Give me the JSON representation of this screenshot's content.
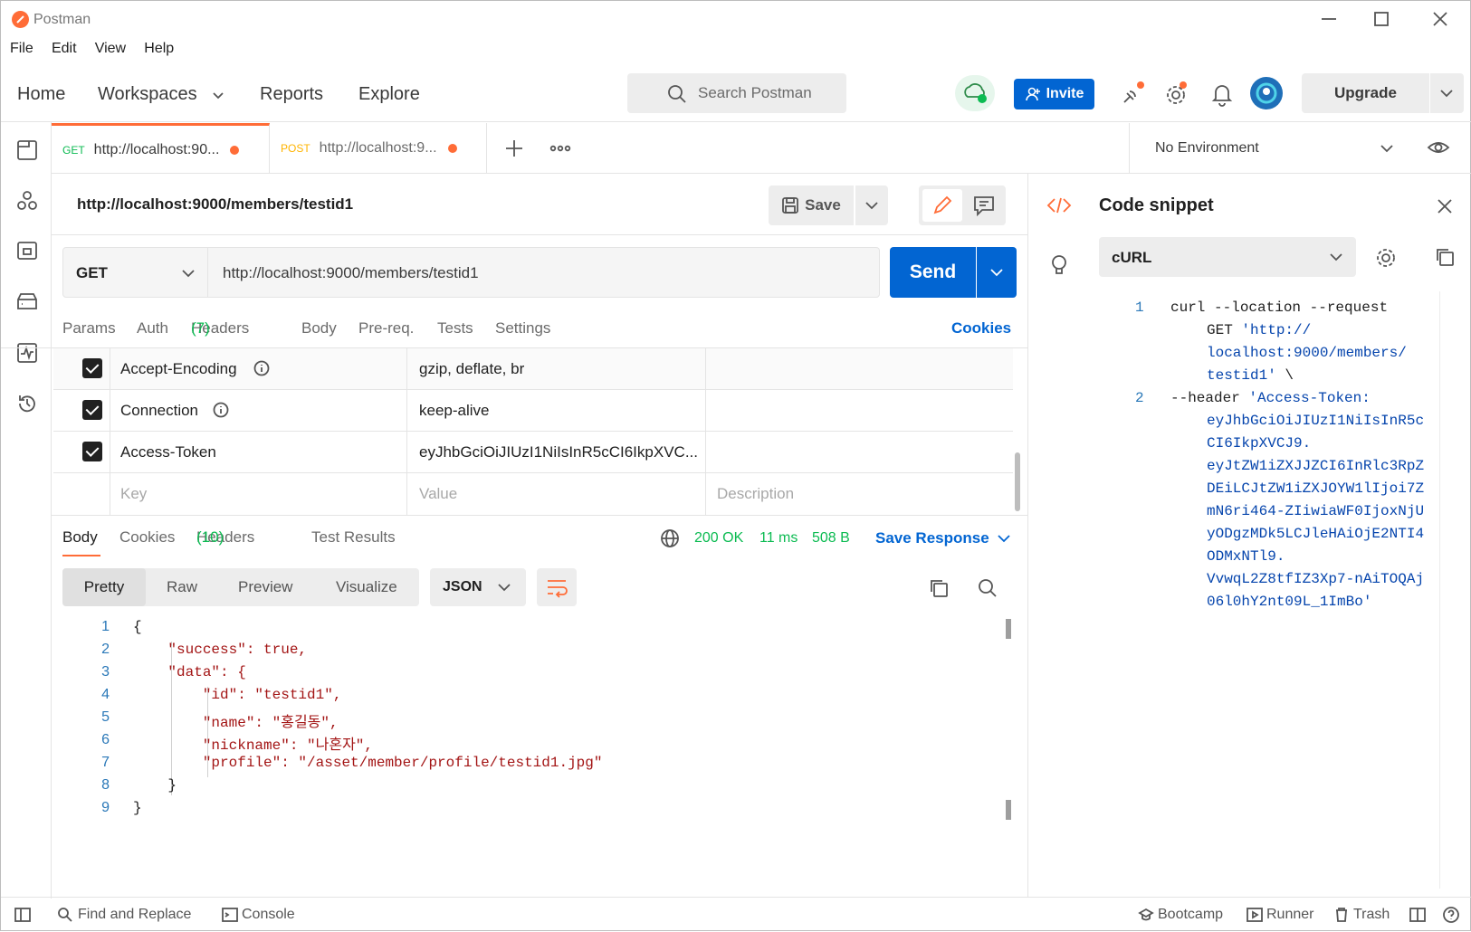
{
  "title_bar": {
    "app_name": "Postman"
  },
  "menu": [
    "File",
    "Edit",
    "View",
    "Help"
  ],
  "nav": {
    "home": "Home",
    "workspaces": "Workspaces",
    "reports": "Reports",
    "explore": "Explore",
    "search_placeholder": "Search Postman",
    "invite": "Invite",
    "upgrade": "Upgrade"
  },
  "tabs": [
    {
      "method": "GET",
      "url": "http://localhost:90...",
      "method_color": "#0cbb52"
    },
    {
      "method": "POST",
      "url": "http://localhost:9...",
      "method_color": "#ffb400"
    }
  ],
  "environment": {
    "selected": "No Environment"
  },
  "request": {
    "title": "http://localhost:9000/members/testid1",
    "save": "Save",
    "method": "GET",
    "url": "http://localhost:9000/members/testid1",
    "send": "Send",
    "subtabs": {
      "params": "Params",
      "auth": "Auth",
      "headers": "Headers",
      "headers_count": "(7)",
      "body": "Body",
      "prereq": "Pre-req.",
      "tests": "Tests",
      "settings": "Settings",
      "cookies": "Cookies"
    },
    "headers": [
      {
        "key": "Accept-Encoding",
        "value": "gzip, deflate, br",
        "checked": true
      },
      {
        "key": "Connection",
        "value": "keep-alive",
        "checked": true
      },
      {
        "key": "Access-Token",
        "value": "eyJhbGciOiJIUzI1NiIsInR5cCI6IkpXVC...",
        "checked": true
      }
    ],
    "placeholders": {
      "key": "Key",
      "value": "Value",
      "description": "Description"
    }
  },
  "response": {
    "tabs": {
      "body": "Body",
      "cookies": "Cookies",
      "headers": "Headers",
      "headers_count": "(10)",
      "test_results": "Test Results"
    },
    "status": "200 OK",
    "time": "11 ms",
    "size": "508 B",
    "save_response": "Save Response",
    "views": [
      "Pretty",
      "Raw",
      "Preview",
      "Visualize"
    ],
    "format": "JSON",
    "lines": [
      "{",
      "    \"success\": true,",
      "    \"data\": {",
      "        \"id\": \"testid1\",",
      "        \"name\": \"홍길동\",",
      "        \"nickname\": \"나혼자\",",
      "        \"profile\": \"/asset/member/profile/testid1.jpg\"",
      "    }",
      "}"
    ],
    "line_numbers": [
      "1",
      "2",
      "3",
      "4",
      "5",
      "6",
      "7",
      "8",
      "9"
    ]
  },
  "snippet": {
    "title": "Code snippet",
    "language": "cURL",
    "line_numbers": [
      "1",
      "2"
    ],
    "line1_a": "curl --location --request",
    "line1_b": "GET ",
    "line1_url": [
      "'http://",
      "localhost:9000/members/",
      "testid1'"
    ],
    "line1_tail": " \\",
    "line2_a": "--header ",
    "line2_token": [
      "'Access-Token:",
      "eyJhbGciOiJIUzI1NiIsInR5c",
      "CI6IkpXVCJ9.",
      "eyJtZW1iZXJJZCI6InRlc3RpZ",
      "DEiLCJtZW1iZXJOYW1lIjoi7Z",
      "mN6ri464-ZIiwiaWF0IjoxNjU",
      "yODgzMDk5LCJleHAiOjE2NTI4",
      "ODMxNTl9.",
      "VvwqL2Z8tfIZ3Xp7-nAiTOQAj",
      "06l0hY2nt09L_1ImBo'"
    ]
  },
  "statusbar": {
    "find_replace": "Find and Replace",
    "console": "Console",
    "bootcamp": "Bootcamp",
    "runner": "Runner",
    "trash": "Trash"
  },
  "colors": {
    "accent": "#ff6c37",
    "send": "#0265d2",
    "success": "#0cbb52"
  }
}
